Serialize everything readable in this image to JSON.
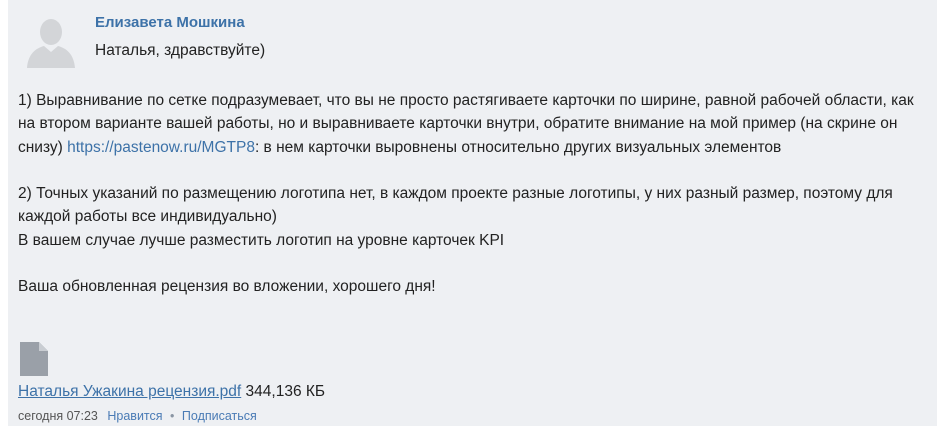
{
  "comment": {
    "author": "Елизавета Мошкина",
    "greeting": "Наталья, здравствуйте)",
    "p1_before_link": "1) Выравнивание по сетке подразумевает, что вы не просто растягиваете карточки по ширине, равной рабочей области, как на втором варианте вашей работы, но и выравниваете карточки внутри, обратите внимание на мой пример (на скрине он снизу) ",
    "p1_link": "https://pastenow.ru/MGTP8",
    "p1_after_link": ": в нем карточки выровнены относительно других визуальных элементов",
    "p2_line1": "2) Точных указаний по размещению логотипа нет, в каждом проекте разные логотипы, у них разный размер, поэтому для каждой работы все индивидуально)",
    "p2_line2": "В вашем случае лучше разместить логотип на уровне карточек KPI",
    "p3": "Ваша обновленная рецензия во вложении, хорошего дня!",
    "attachment": {
      "icon": "file-icon",
      "file_name": "Наталья Ужакина рецензия.pdf",
      "file_size": "344,136 КБ"
    },
    "meta": {
      "time": "сегодня 07:23",
      "like_label": "Нравится",
      "subscribe_label": "Подписаться",
      "separator": "•"
    },
    "avatar_icon": "user-silhouette-icon"
  },
  "colors": {
    "background": "#eef0f3",
    "link": "#3d72a8",
    "text": "#222222",
    "avatar": "#d0d2d5"
  }
}
